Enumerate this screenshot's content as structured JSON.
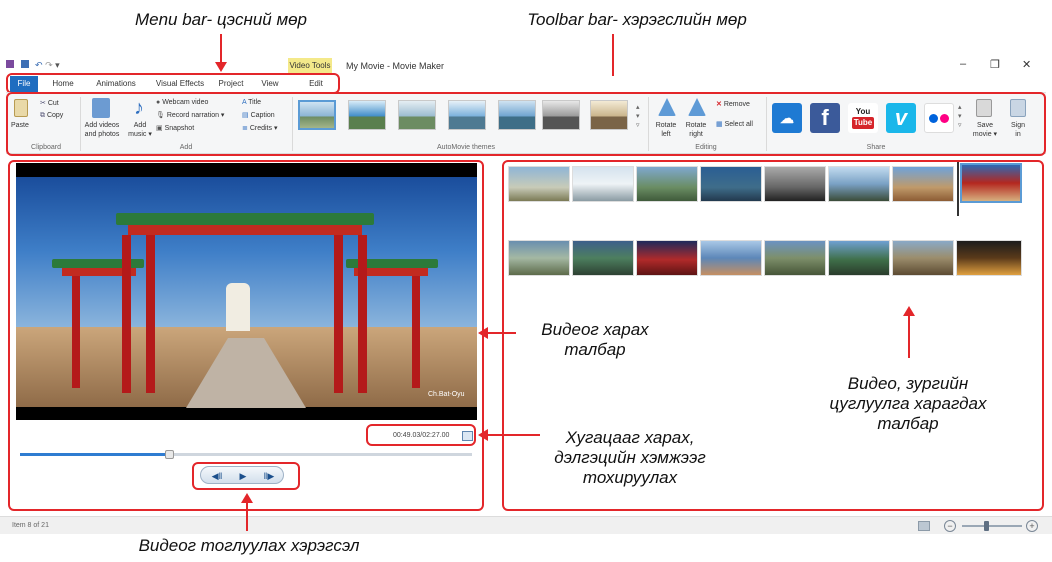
{
  "annotations": {
    "menu_bar": "Menu bar- цэсний мөр",
    "toolbar_bar": "Toolbar bar- хэрэгслийн мөр",
    "video_view_line1": "Видеог харах",
    "video_view_line2": "талбар",
    "time_line1": "Хугацааг харах,",
    "time_line2": "дэлгэцийн хэмжээг",
    "time_line3": "тохируулах",
    "gallery_line1": "Видео, зургийн",
    "gallery_line2": "цуглуулга харагдах",
    "gallery_line3": "талбар",
    "player_tools": "Видеог тоглуулах хэрэгсэл"
  },
  "window": {
    "title": "My Movie - Movie Maker",
    "context_tab": "Video Tools",
    "minimize": "–",
    "maximize": "❐",
    "close": "✕",
    "help": "?"
  },
  "menu": {
    "items": [
      "File",
      "Home",
      "Animations",
      "Visual Effects",
      "Project",
      "View",
      "Edit"
    ]
  },
  "ribbon": {
    "clipboard": {
      "paste": "Paste",
      "cut": "Cut",
      "copy": "Copy",
      "group": "Clipboard"
    },
    "add": {
      "add_videos": "Add videos",
      "and_photos": "and photos",
      "add_music_1": "Add",
      "add_music_2": "music",
      "webcam": "Webcam video",
      "narration": "Record narration",
      "snapshot": "Snapshot",
      "title": "Title",
      "caption": "Caption",
      "credits": "Credits",
      "group": "Add"
    },
    "themes": {
      "group": "AutoMovie themes"
    },
    "editing": {
      "rotate_left_1": "Rotate",
      "rotate_left_2": "left",
      "rotate_right_1": "Rotate",
      "rotate_right_2": "right",
      "remove": "Remove",
      "select_all": "Select all",
      "group": "Editing"
    },
    "share": {
      "youtube_1": "You",
      "youtube_2": "Tube",
      "facebook": "f",
      "vimeo": "v",
      "save_movie_1": "Save",
      "save_movie_2": "movie",
      "sign_in_1": "Sign",
      "sign_in_2": "in",
      "group": "Share"
    }
  },
  "preview": {
    "watermark": "Ch.Bat-Oyu",
    "timecode": "00:49.03/02:27.00",
    "progress_fraction": 0.33,
    "controls": {
      "prev": "◀‖",
      "play": "▶",
      "next": "‖▶"
    }
  },
  "status": {
    "text": "Item 8 of 21",
    "zoom_fraction": 0.4
  },
  "colors": {
    "accent": "#1f6dc0",
    "annotation": "#e3262a"
  }
}
